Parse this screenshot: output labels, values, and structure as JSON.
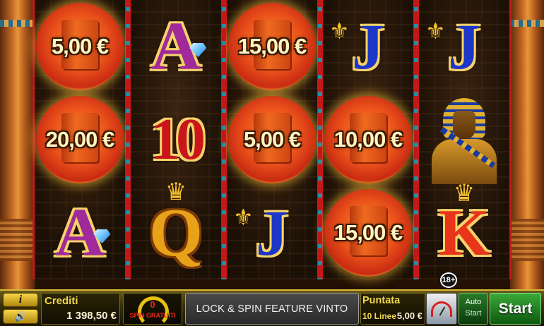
{
  "game": {
    "reels": [
      [
        {
          "type": "coin",
          "name": "coin-bonus-symbol",
          "amount": "5,00 €"
        },
        {
          "type": "coin",
          "name": "coin-bonus-symbol",
          "amount": "20,00 €"
        },
        {
          "type": "card",
          "name": "ace-symbol",
          "label": "A",
          "decor": "gem"
        }
      ],
      [
        {
          "type": "card",
          "name": "ace-symbol",
          "label": "A",
          "decor": "gem"
        },
        {
          "type": "card",
          "name": "ten-symbol",
          "label": "10"
        },
        {
          "type": "card",
          "name": "queen-symbol",
          "label": "Q",
          "decor": "crown"
        }
      ],
      [
        {
          "type": "coin",
          "name": "coin-bonus-symbol",
          "amount": "15,00 €"
        },
        {
          "type": "coin",
          "name": "coin-bonus-symbol",
          "amount": "5,00 €"
        },
        {
          "type": "card",
          "name": "jack-symbol",
          "label": "J",
          "decor": "fleur"
        }
      ],
      [
        {
          "type": "card",
          "name": "jack-symbol",
          "label": "J",
          "decor": "fleur"
        },
        {
          "type": "coin",
          "name": "coin-bonus-symbol",
          "amount": "10,00 €"
        },
        {
          "type": "coin",
          "name": "coin-bonus-symbol",
          "amount": "15,00 €"
        }
      ],
      [
        {
          "type": "card",
          "name": "jack-symbol",
          "label": "J",
          "decor": "fleur"
        },
        {
          "type": "pharaoh",
          "name": "pharaoh-symbol"
        },
        {
          "type": "card",
          "name": "king-symbol",
          "label": "K",
          "decor": "crown"
        }
      ]
    ]
  },
  "age_badge": "18+",
  "controls": {
    "info_label": "i",
    "sound_icon": "speaker-icon",
    "credits_label": "Crediti",
    "credits_value": "1 398,50 €",
    "free_spins_count": "0",
    "free_spins_label": "SPIN GRATUITI",
    "message": "LOCK & SPIN FEATURE VINTO",
    "bet_label": "Puntata",
    "bet_lines": "10 Linee",
    "bet_value": "5,00 €",
    "gamble_icon": "gauge-icon",
    "auto_label": "Auto",
    "auto_start_label": "Start",
    "start_label": "Start"
  },
  "colors": {
    "accent_gold": "#d8b83a",
    "reel_border_red": "#c21818",
    "start_green": "#3aa83a"
  }
}
